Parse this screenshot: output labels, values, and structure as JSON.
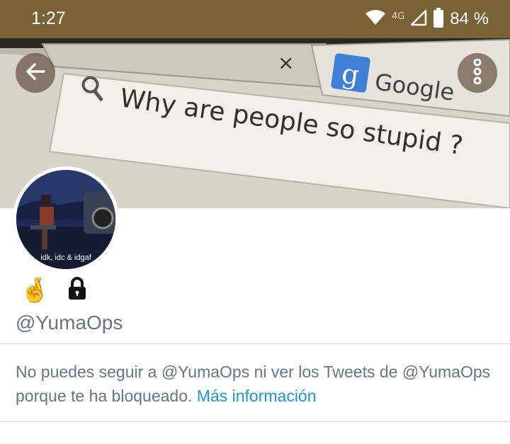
{
  "status_bar": {
    "time": "1:27",
    "network": "4G",
    "battery": "84 %",
    "wifi_icon": "wifi-icon",
    "signal_icon": "signal-icon",
    "battery_icon": "battery-icon"
  },
  "header": {
    "back_icon": "arrow-left-icon",
    "more_icon": "more-vertical-icon",
    "banner_text": {
      "browser_brand": "Google",
      "search_query": "Why are people so stupid ?",
      "tab_close": "×",
      "logo_letter": "g"
    }
  },
  "profile": {
    "avatar_caption": "idk, idc & idgaf",
    "emoji": "🤞",
    "lock_icon": "lock-icon",
    "handle": "@YumaOps"
  },
  "blocked_notice": {
    "text": "No puedes seguir a @YumaOps ni ver los Tweets de @YumaOps porque te ha bloqueado.",
    "link": "Más información"
  },
  "colors": {
    "status_bar_bg": "#7a6236",
    "secondary_text": "#657786",
    "link": "#1b95e0"
  }
}
